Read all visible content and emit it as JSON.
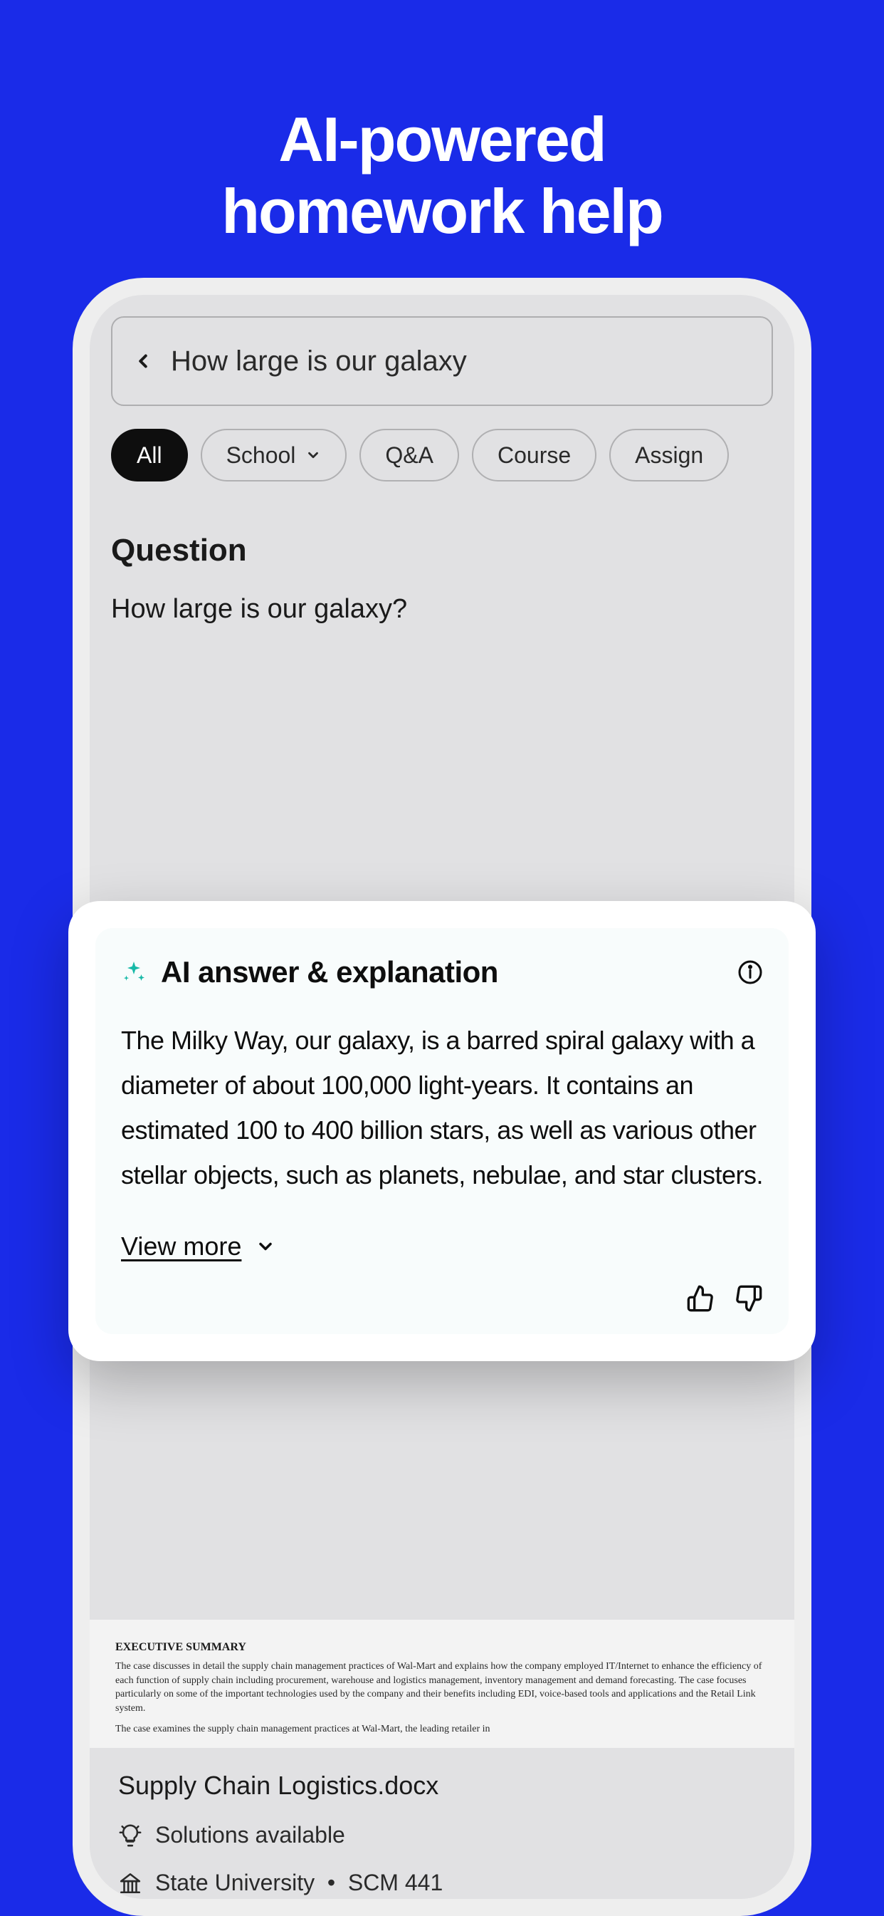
{
  "headline": {
    "line1": "AI-powered",
    "line2": "homework help"
  },
  "search": {
    "query": "How large is our galaxy"
  },
  "filters": {
    "all": "All",
    "school": "School",
    "qa": "Q&A",
    "course": "Course",
    "assignment": "Assign"
  },
  "question": {
    "label": "Question",
    "text": "How large is our galaxy?"
  },
  "ai": {
    "title": "AI answer & explanation",
    "body": "The Milky Way, our galaxy, is a barred spiral galaxy with a diameter of about 100,000 light-years. It contains an estimated 100 to 400 billion stars, as well as various other stellar objects, such as planets, nebulae, and star clusters.",
    "view_more": "View more"
  },
  "doc_preview": {
    "title": "EXECUTIVE SUMMARY",
    "body": "The case discusses in detail the supply chain management practices of Wal-Mart and explains how the company employed IT/Internet to enhance the efficiency of each function of supply chain including procurement, warehouse and logistics management, inventory management and demand forecasting. The case focuses particularly on some of the important technologies used by the company and their benefits including EDI, voice-based tools and applications and the Retail Link system.",
    "subline": "The case examines the supply chain management practices at Wal-Mart, the leading retailer in"
  },
  "doc": {
    "name": "Supply Chain Logistics.docx",
    "solutions": "Solutions available",
    "school": "State University",
    "course": "SCM 441"
  }
}
